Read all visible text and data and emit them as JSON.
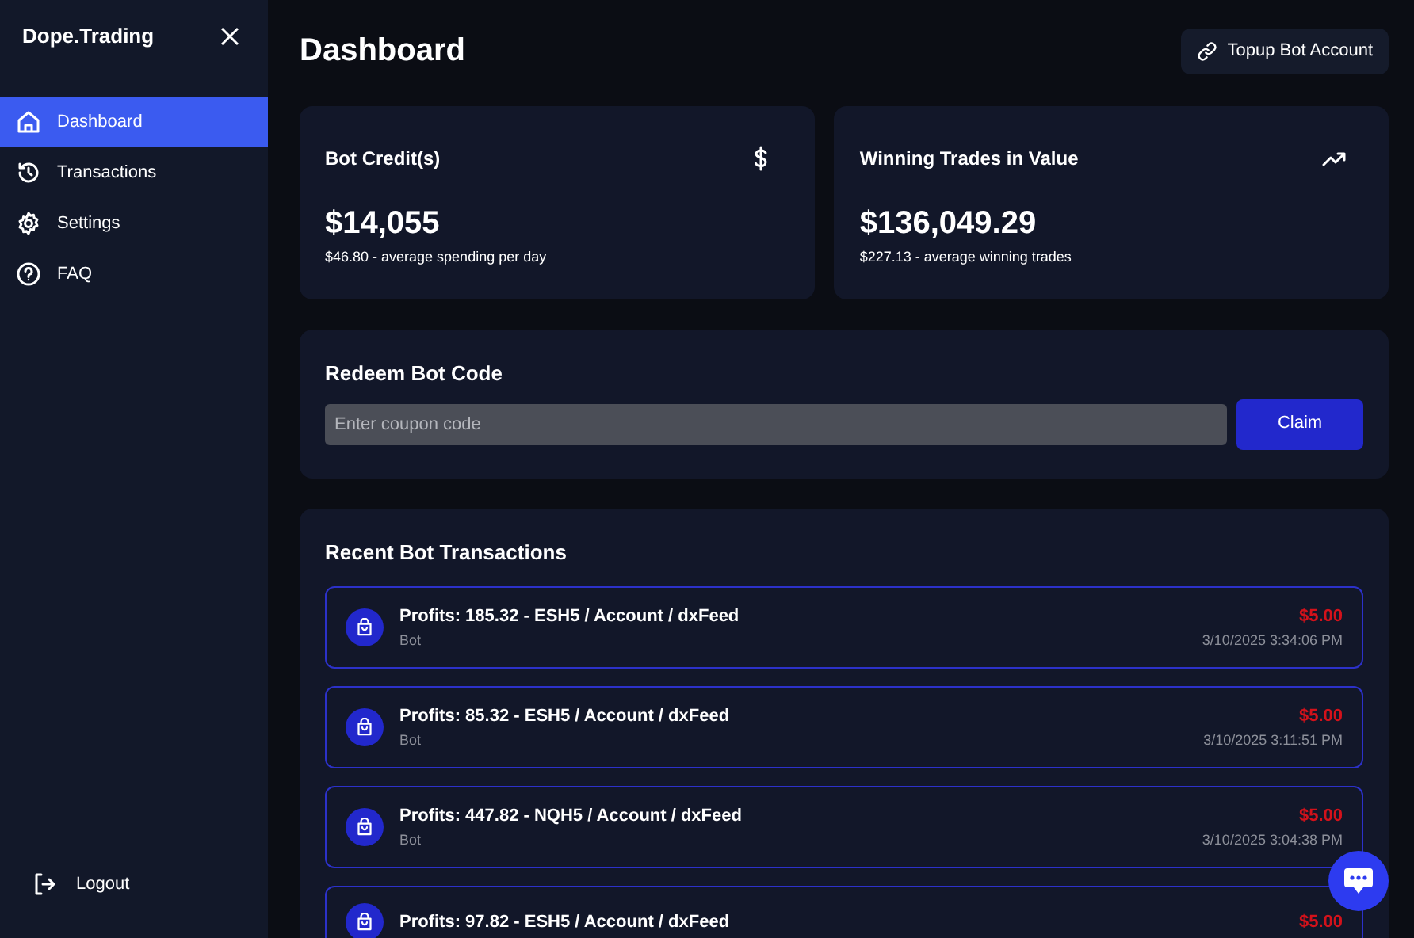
{
  "brand": "Dope.Trading",
  "sidebar": {
    "items": [
      {
        "label": "Dashboard",
        "kind": "home",
        "selected": true
      },
      {
        "label": "Transactions",
        "kind": "history",
        "selected": false
      },
      {
        "label": "Settings",
        "kind": "gear",
        "selected": false
      },
      {
        "label": "FAQ",
        "kind": "help",
        "selected": false
      }
    ],
    "logout": "Logout"
  },
  "page_title": "Dashboard",
  "topup_button": "Topup Bot Account",
  "stats": [
    {
      "title": "Bot Credit(s)",
      "kind": "dollar",
      "value": "$14,055",
      "note": "$46.80 - average spending per day"
    },
    {
      "title": "Winning Trades in Value",
      "kind": "trend",
      "value": "$136,049.29",
      "note": "$227.13 - average winning trades"
    }
  ],
  "redeem": {
    "title": "Redeem Bot Code",
    "placeholder": "Enter coupon code",
    "button": "Claim"
  },
  "transactions": {
    "title": "Recent Bot Transactions",
    "rows": [
      {
        "title": "Profits: 185.32 - ESH5 / Account / dxFeed",
        "source": "Bot",
        "amount": "$5.00",
        "time": "3/10/2025 3:34:06 PM"
      },
      {
        "title": "Profits: 85.32 - ESH5 / Account / dxFeed",
        "source": "Bot",
        "amount": "$5.00",
        "time": "3/10/2025 3:11:51 PM"
      },
      {
        "title": "Profits: 447.82 - NQH5 / Account / dxFeed",
        "source": "Bot",
        "amount": "$5.00",
        "time": "3/10/2025 3:04:38 PM"
      },
      {
        "title": "Profits: 97.82 - ESH5 / Account / dxFeed",
        "amount": "$5.00"
      }
    ]
  }
}
